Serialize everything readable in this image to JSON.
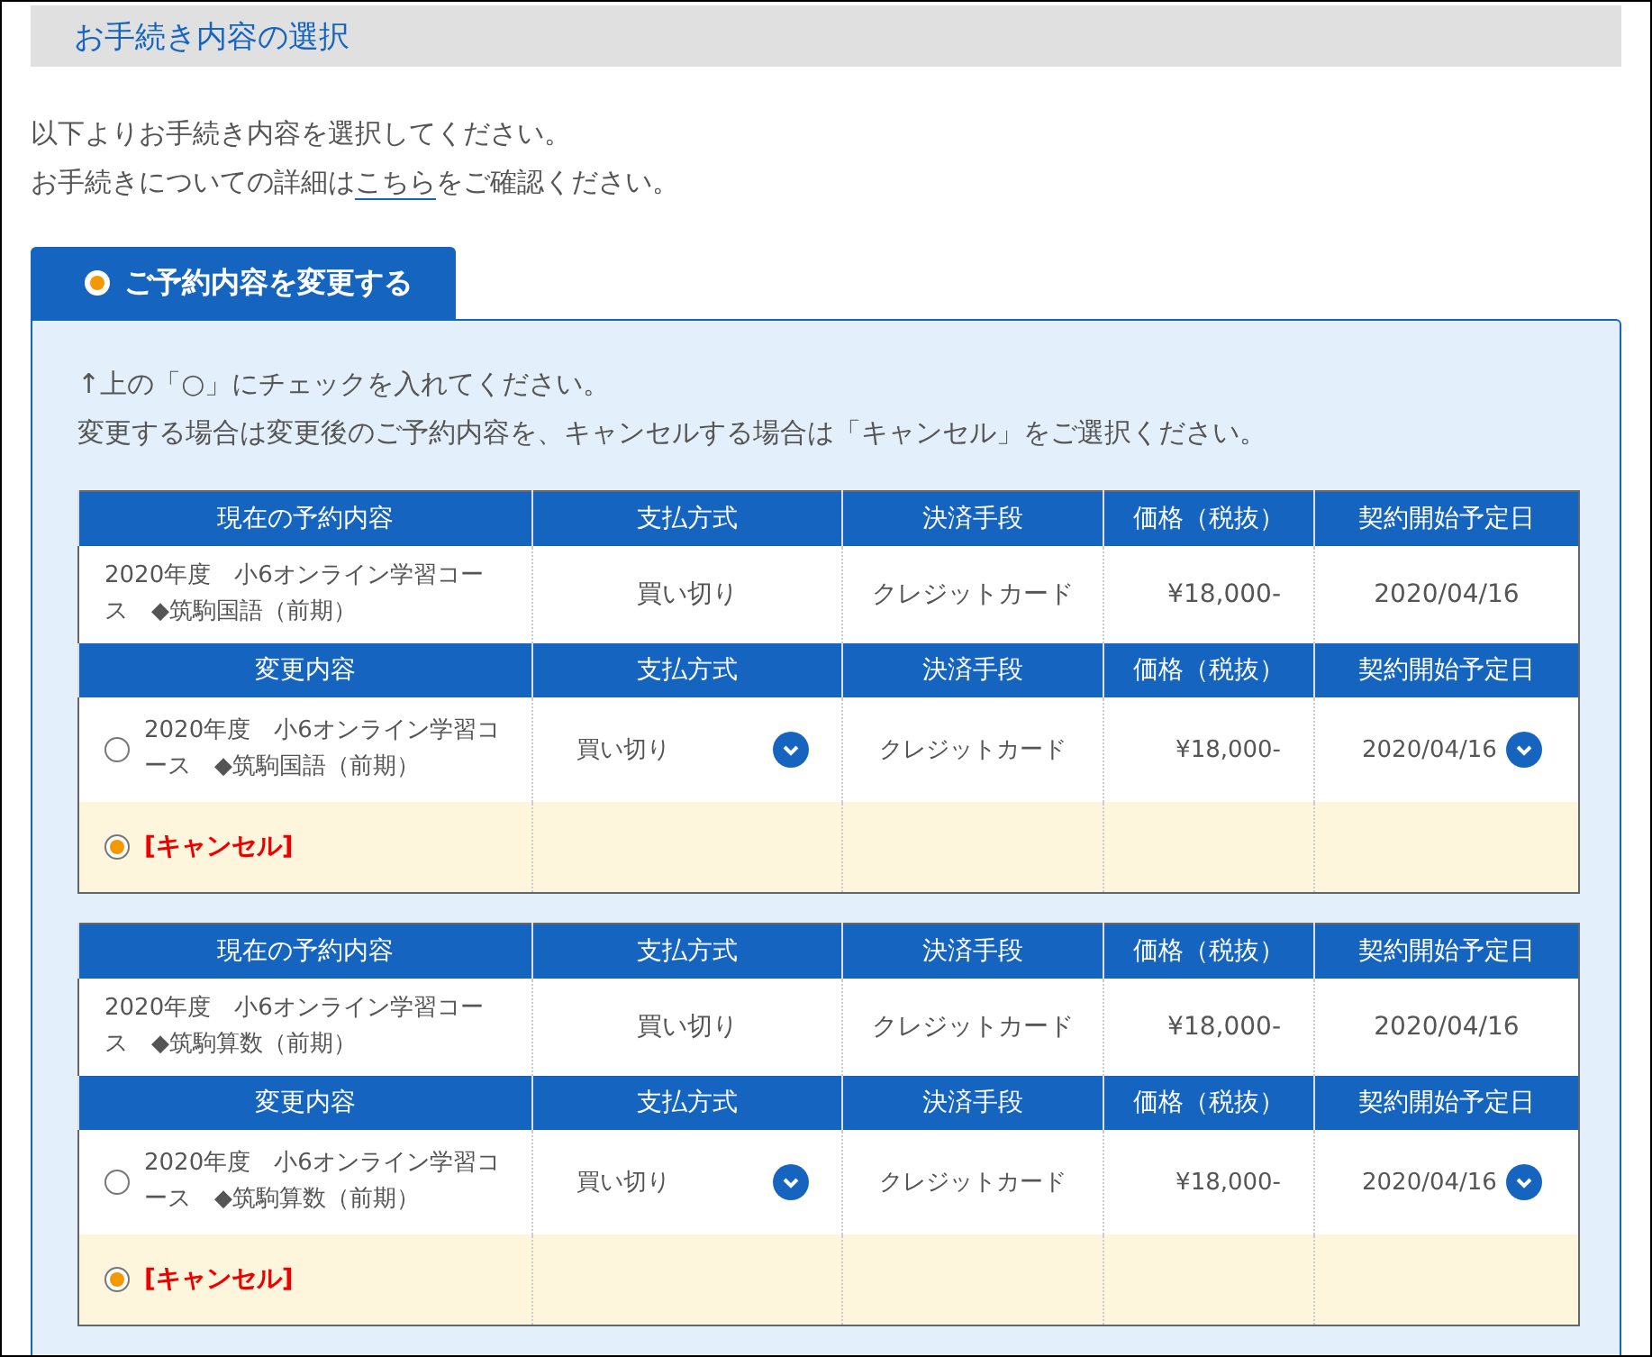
{
  "section_title": "お手続き内容の選択",
  "intro": {
    "line1": "以下よりお手続き内容を選択してください。",
    "line2_before": "お手続きについての詳細は",
    "link": "こちら",
    "line2_after": "をご確認ください。"
  },
  "tab": {
    "label": "ご予約内容を変更する",
    "selected": true
  },
  "instructions": [
    "↑上の「○」にチェックを入れてください。",
    "変更する場合は変更後のご予約内容を、キャンセルする場合は「キャンセル」をご選択ください。"
  ],
  "blocks": [
    {
      "current_columns": [
        "現在の予約内容",
        "支払方式",
        "決済手段",
        "価格（税抜）",
        "契約開始予定日"
      ],
      "current": {
        "course": "2020年度　小6オンライン学習コース　◆筑駒国語（前期）",
        "payment": "買い切り",
        "method": "クレジットカード",
        "price": "¥18,000-",
        "date": "2020/04/16"
      },
      "change_columns": [
        "変更内容",
        "支払方式",
        "決済手段",
        "価格（税抜）",
        "契約開始予定日"
      ],
      "options": [
        {
          "kind": "course",
          "selected": false,
          "course": "2020年度　小6オンライン学習コース　◆筑駒国語（前期）",
          "payment": "買い切り",
          "method": "クレジットカード",
          "price": "¥18,000-",
          "date": "2020/04/16"
        },
        {
          "kind": "cancel",
          "selected": true,
          "label": "[キャンセル]"
        }
      ]
    },
    {
      "current_columns": [
        "現在の予約内容",
        "支払方式",
        "決済手段",
        "価格（税抜）",
        "契約開始予定日"
      ],
      "current": {
        "course": "2020年度　小6オンライン学習コース　◆筑駒算数（前期）",
        "payment": "買い切り",
        "method": "クレジットカード",
        "price": "¥18,000-",
        "date": "2020/04/16"
      },
      "change_columns": [
        "変更内容",
        "支払方式",
        "決済手段",
        "価格（税抜）",
        "契約開始予定日"
      ],
      "options": [
        {
          "kind": "course",
          "selected": false,
          "course": "2020年度　小6オンライン学習コース　◆筑駒算数（前期）",
          "payment": "買い切り",
          "method": "クレジットカード",
          "price": "¥18,000-",
          "date": "2020/04/16"
        },
        {
          "kind": "cancel",
          "selected": true,
          "label": "[キャンセル]"
        }
      ]
    }
  ]
}
